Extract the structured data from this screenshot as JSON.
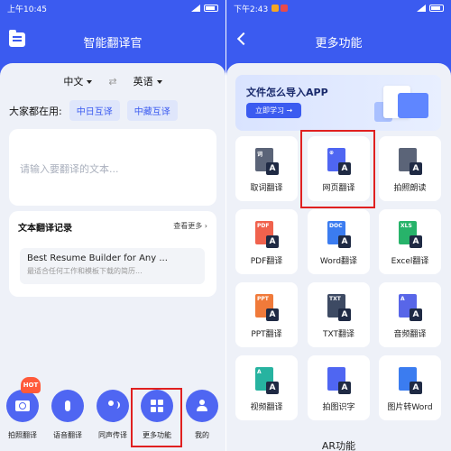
{
  "left": {
    "status": {
      "time": "上午10:45"
    },
    "title": "智能翻译官",
    "lang": {
      "source": "中文",
      "target": "英语"
    },
    "frequent": {
      "label": "大家都在用:",
      "chips": [
        "中日互译",
        "中藏互译"
      ]
    },
    "input": {
      "placeholder": "请输入要翻译的文本..."
    },
    "history": {
      "title": "文本翻译记录",
      "more": "查看更多",
      "item_title": "Best Resume Builder for Any ...",
      "item_subtitle": "最适合任何工作和模板下载的简历..."
    },
    "nav": [
      {
        "label": "拍照翻译",
        "icon": "camera-icon",
        "badge": "HOT"
      },
      {
        "label": "语音翻译",
        "icon": "microphone-icon"
      },
      {
        "label": "同声传译",
        "icon": "interpret-icon"
      },
      {
        "label": "更多功能",
        "icon": "grid-icon"
      },
      {
        "label": "我的",
        "icon": "profile-icon"
      }
    ]
  },
  "right": {
    "status": {
      "time": "下午2:43"
    },
    "title": "更多功能",
    "banner": {
      "title": "文件怎么导入APP",
      "button": "立即学习 →"
    },
    "tiles": [
      {
        "label": "取词翻译",
        "icon": "word-pick-icon",
        "tag": "词",
        "color": "#5b6478"
      },
      {
        "label": "网页翻译",
        "icon": "web-icon",
        "tag": "⊕",
        "color": "#4f66f2"
      },
      {
        "label": "拍照朗读",
        "icon": "book-camera-icon",
        "tag": "",
        "color": "#5b6478"
      },
      {
        "label": "PDF翻译",
        "icon": "pdf-icon",
        "tag": "PDF",
        "color": "#f0624d"
      },
      {
        "label": "Word翻译",
        "icon": "word-icon",
        "tag": "DOC",
        "color": "#3b7cf0"
      },
      {
        "label": "Excel翻译",
        "icon": "excel-icon",
        "tag": "XLS",
        "color": "#27b36a"
      },
      {
        "label": "PPT翻译",
        "icon": "ppt-icon",
        "tag": "PPT",
        "color": "#f07a3a"
      },
      {
        "label": "TXT翻译",
        "icon": "txt-icon",
        "tag": "TXT",
        "color": "#3d4a63"
      },
      {
        "label": "音频翻译",
        "icon": "audio-icon",
        "tag": "A",
        "color": "#5866e8"
      },
      {
        "label": "视频翻译",
        "icon": "video-icon",
        "tag": "A",
        "color": "#27b3a0"
      },
      {
        "label": "拍图识字",
        "icon": "ocr-icon",
        "tag": "",
        "color": "#4f66f2"
      },
      {
        "label": "图片转Word",
        "icon": "image-to-word-icon",
        "tag": "",
        "color": "#3b7cf0"
      }
    ],
    "section_title": "AR功能"
  }
}
